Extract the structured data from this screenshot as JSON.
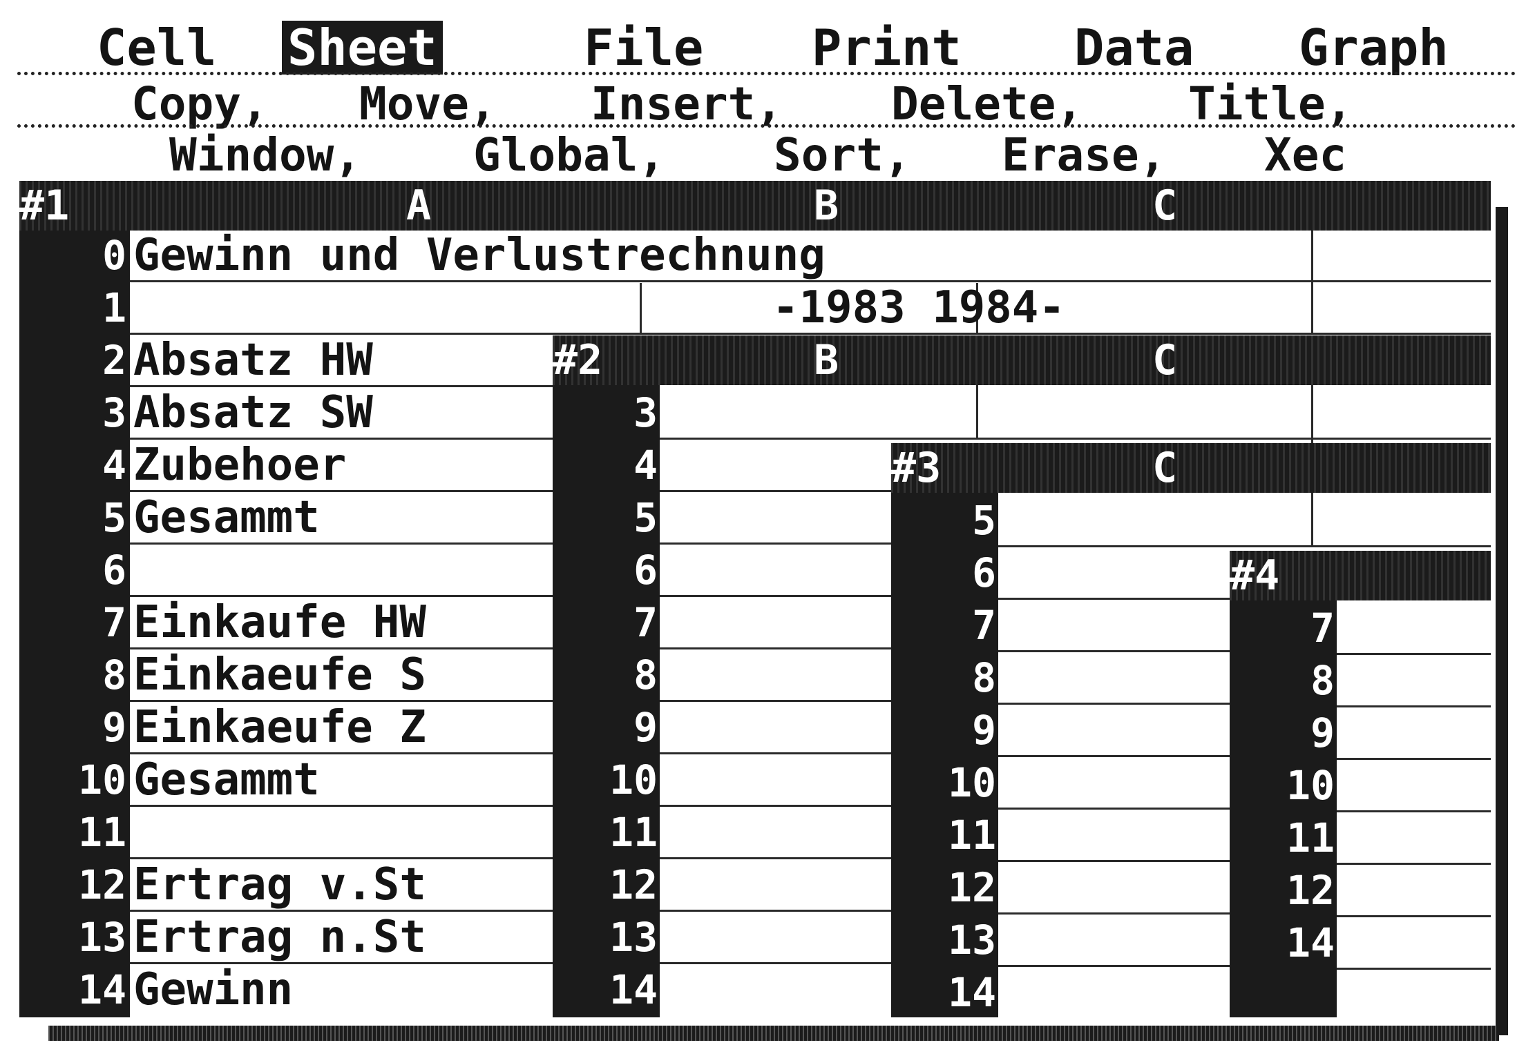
{
  "menu": {
    "items": [
      "Cell",
      "Sheet",
      "File",
      "Print",
      "Data",
      "Graph"
    ],
    "selected": "Sheet"
  },
  "submenu": {
    "line1": [
      "Copy,",
      "Move,",
      "Insert,",
      "Delete,",
      "Title,"
    ],
    "line2": [
      "Window,",
      "Global,",
      "Sort,",
      "Erase,",
      "Xec"
    ]
  },
  "windows": [
    {
      "id": "#1",
      "columns": [
        "A",
        "B",
        "C"
      ],
      "rows": [
        "0",
        "1",
        "2",
        "3",
        "4",
        "5",
        "6",
        "7",
        "8",
        "9",
        "10",
        "11",
        "12",
        "13",
        "14"
      ],
      "cells": {
        "r0": "Gewinn und Verlustrechnung",
        "r1": "-1983 1984-",
        "r2": "Absatz HW",
        "r3": "Absatz SW",
        "r4": "Zubehoer",
        "r5": "Gesammt",
        "r6": "",
        "r7": "Einkaufe HW",
        "r8": "Einkaeufe S",
        "r9": "Einkaeufe Z",
        "r10": "Gesammt",
        "r11": "",
        "r12": "Ertrag v.St",
        "r13": "Ertrag n.St",
        "r14": "Gewinn"
      }
    },
    {
      "id": "#2",
      "columns": [
        "B",
        "C"
      ],
      "rows": [
        "3",
        "4",
        "5",
        "6",
        "7",
        "8",
        "9",
        "10",
        "11",
        "12",
        "13",
        "14"
      ]
    },
    {
      "id": "#3",
      "columns": [
        "C"
      ],
      "rows": [
        "5",
        "6",
        "7",
        "8",
        "9",
        "10",
        "11",
        "12",
        "13",
        "14"
      ]
    },
    {
      "id": "#4",
      "columns": [],
      "rows": [
        "7",
        "8",
        "9",
        "10",
        "11",
        "12",
        "14"
      ]
    }
  ],
  "colors": {
    "background": "#ffffff",
    "ink": "#1b1b1b"
  }
}
